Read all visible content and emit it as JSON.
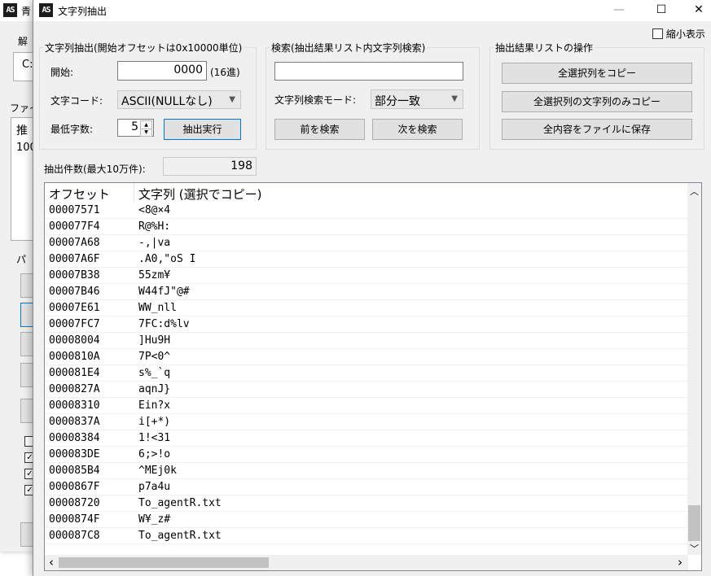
{
  "background_window": {
    "title": "青",
    "fragments": [
      "解",
      "C:",
      "ファイ",
      "推",
      "100",
      "パ"
    ],
    "checkbox_states": [
      false,
      true,
      true,
      true
    ]
  },
  "window": {
    "title": "文字列抽出",
    "controls": {
      "minimize": "—",
      "maximize": "☐",
      "close": "✕"
    }
  },
  "compact_toggle": {
    "label": "縮小表示",
    "checked": false
  },
  "extract": {
    "group_label": "文字列抽出(開始オフセットは0x10000単位)",
    "start_label": "開始:",
    "start_value": "0000",
    "start_unit": "(16進)",
    "charcode_label": "文字コード:",
    "charcode_value": "ASCII(NULLなし)",
    "minlen_label": "最低字数:",
    "minlen_value": "5",
    "run_button": "抽出実行"
  },
  "search": {
    "group_label": "検索(抽出結果リスト内文字列検索)",
    "query_value": "",
    "mode_label": "文字列検索モード:",
    "mode_value": "部分一致",
    "prev_button": "前を検索",
    "next_button": "次を検索"
  },
  "list_ops": {
    "group_label": "抽出結果リストの操作",
    "copy_all_button": "全選択列をコピー",
    "copy_strings_button": "全選択列の文字列のみコピー",
    "save_button": "全内容をファイルに保存"
  },
  "count": {
    "label": "抽出件数(最大10万件):",
    "value": "198"
  },
  "results": {
    "columns": [
      "オフセット",
      "文字列 (選択でコピー)"
    ],
    "rows": [
      {
        "offset": "00007571",
        "text": "<8@×4"
      },
      {
        "offset": "000077F4",
        "text": "R@%H:"
      },
      {
        "offset": "00007A68",
        "text": "-,|va"
      },
      {
        "offset": "00007A6F",
        "text": ".A0,\"oS I"
      },
      {
        "offset": "00007B38",
        "text": "55zm¥"
      },
      {
        "offset": "00007B46",
        "text": "W44fJ\"@#"
      },
      {
        "offset": "00007E61",
        "text": "WW_nll"
      },
      {
        "offset": "00007FC7",
        "text": "7FC:d%lv"
      },
      {
        "offset": "00008004",
        "text": "]Hu9H"
      },
      {
        "offset": "0000810A",
        "text": "7P<0^"
      },
      {
        "offset": "000081E4",
        "text": "s%_`q"
      },
      {
        "offset": "0000827A",
        "text": "aqnJ}"
      },
      {
        "offset": "00008310",
        "text": "Ein?x"
      },
      {
        "offset": "0000837A",
        "text": "i[+*)"
      },
      {
        "offset": "00008384",
        "text": "1!<31"
      },
      {
        "offset": "000083DE",
        "text": "6;>!o"
      },
      {
        "offset": "000085B4",
        "text": "^MEj0k"
      },
      {
        "offset": "0000867F",
        "text": "p7a4u"
      },
      {
        "offset": "00008720",
        "text": "To_agentR.txt"
      },
      {
        "offset": "0000874F",
        "text": "W¥_z#"
      },
      {
        "offset": "000087C8",
        "text": "To_agentR.txt"
      }
    ]
  },
  "scrollbars": {
    "up": "︿",
    "down": "﹀",
    "left": "‹",
    "right": "›"
  }
}
